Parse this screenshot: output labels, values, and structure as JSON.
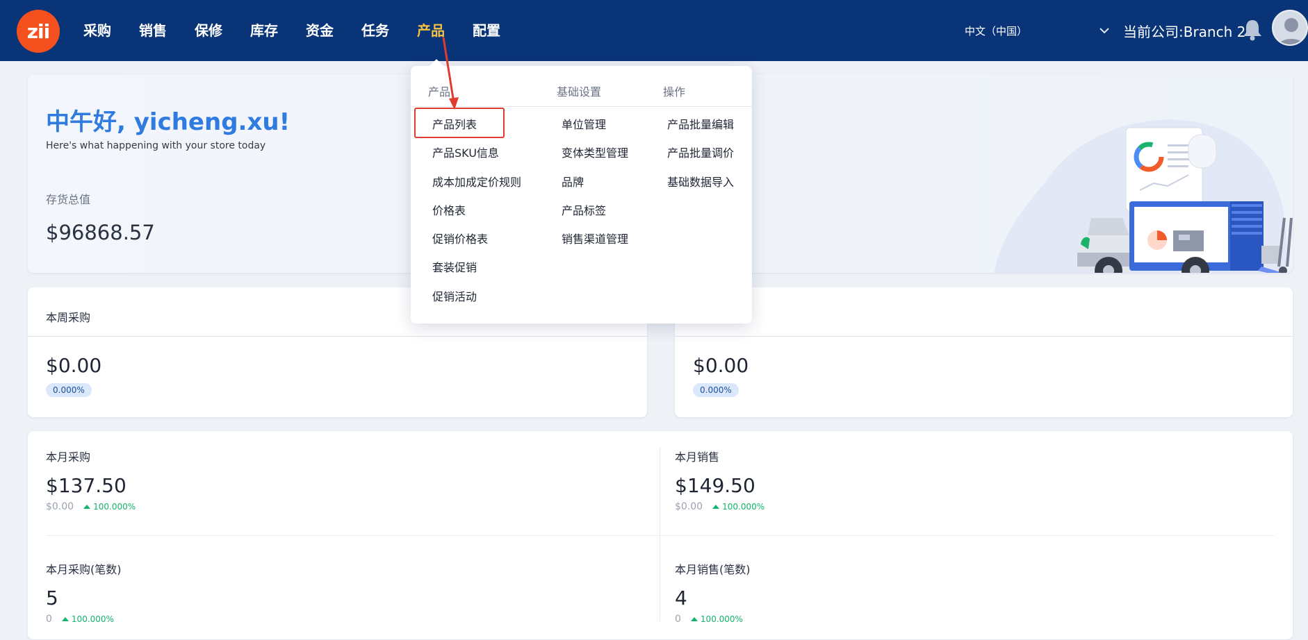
{
  "header": {
    "logo_text": "zii",
    "nav": [
      {
        "label": "采购"
      },
      {
        "label": "销售"
      },
      {
        "label": "保修"
      },
      {
        "label": "库存"
      },
      {
        "label": "资金"
      },
      {
        "label": "任务"
      },
      {
        "label": "产品",
        "active": true
      },
      {
        "label": "配置"
      }
    ],
    "language": "中文（中国）",
    "company": "当前公司:Branch 2",
    "icons": {
      "language_toggle": "chevron-down-icon",
      "notifications": "bell-icon",
      "user": "avatar-icon"
    }
  },
  "welcome": {
    "greeting": "中午好, yicheng.xu!",
    "subtitle": "Here's what happening with your store today",
    "inventory_label": "存货总值",
    "inventory_value": "$96868.57"
  },
  "week": {
    "purchase": {
      "title": "本周采购",
      "value": "$0.00",
      "change": "0.000%"
    },
    "sales": {
      "value": "$0.00",
      "change": "0.000%"
    }
  },
  "month": {
    "purchase": {
      "title": "本月采购",
      "value": "$137.50",
      "previous": "$0.00",
      "change": "100.000%"
    },
    "sales": {
      "title": "本月销售",
      "value": "$149.50",
      "previous": "$0.00",
      "change": "100.000%"
    },
    "purchase_count": {
      "title": "本月采购(笔数)",
      "value": "5",
      "previous": "0",
      "change": "100.000%"
    },
    "sales_count": {
      "title": "本月销售(笔数)",
      "value": "4",
      "previous": "0",
      "change": "100.000%"
    }
  },
  "dropdown": {
    "columns": [
      {
        "heading": "产品",
        "items": [
          "产品列表",
          "产品SKU信息",
          "成本加成定价规则",
          "价格表",
          "促销价格表",
          "套装促销",
          "促销活动"
        ]
      },
      {
        "heading": "基础设置",
        "items": [
          "单位管理",
          "变体类型管理",
          "品牌",
          "产品标签",
          "销售渠道管理"
        ]
      },
      {
        "heading": "操作",
        "items": [
          "产品批量编辑",
          "产品批量调价",
          "基础数据导入"
        ]
      }
    ],
    "highlighted_item": "产品列表"
  },
  "colors": {
    "topbar": "#0a3478",
    "nav_active": "#f5c242",
    "logo": "#f4511e",
    "greeting": "#2f7be0",
    "positive": "#12b36b",
    "annotation": "#e03b2f"
  }
}
